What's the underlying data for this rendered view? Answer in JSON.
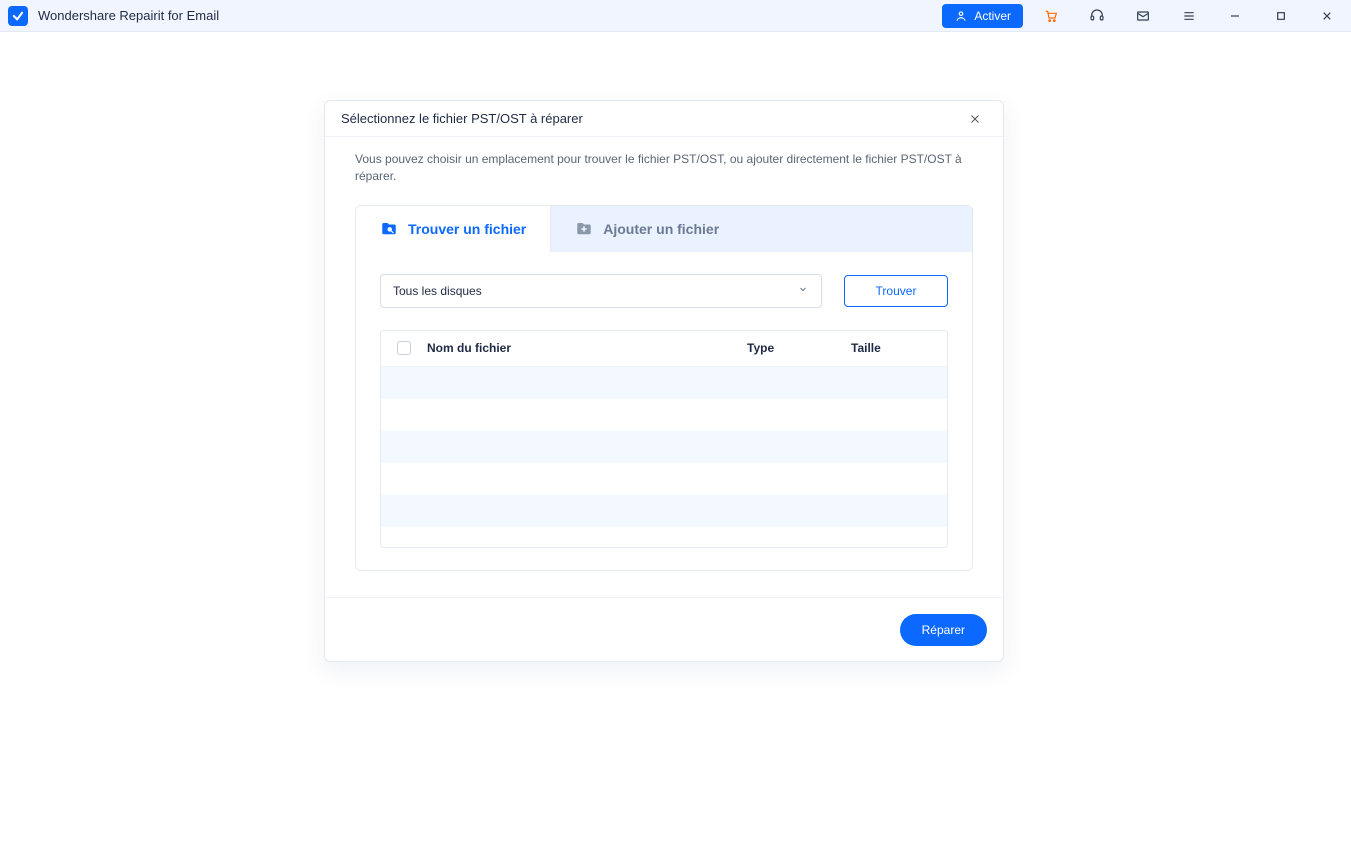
{
  "titlebar": {
    "app_title": "Wondershare Repairit for Email",
    "activate_label": "Activer"
  },
  "modal": {
    "title": "Sélectionnez le fichier PST/OST à réparer",
    "description": "Vous pouvez choisir un emplacement pour trouver le fichier PST/OST, ou ajouter directement le fichier PST/OST à réparer.",
    "tabs": {
      "find_label": "Trouver un fichier",
      "add_label": "Ajouter un fichier"
    },
    "controls": {
      "drive_selected": "Tous les disques",
      "find_button": "Trouver"
    },
    "table": {
      "col_name": "Nom du fichier",
      "col_type": "Type",
      "col_size": "Taille"
    },
    "footer": {
      "repair_button": "Réparer"
    }
  }
}
